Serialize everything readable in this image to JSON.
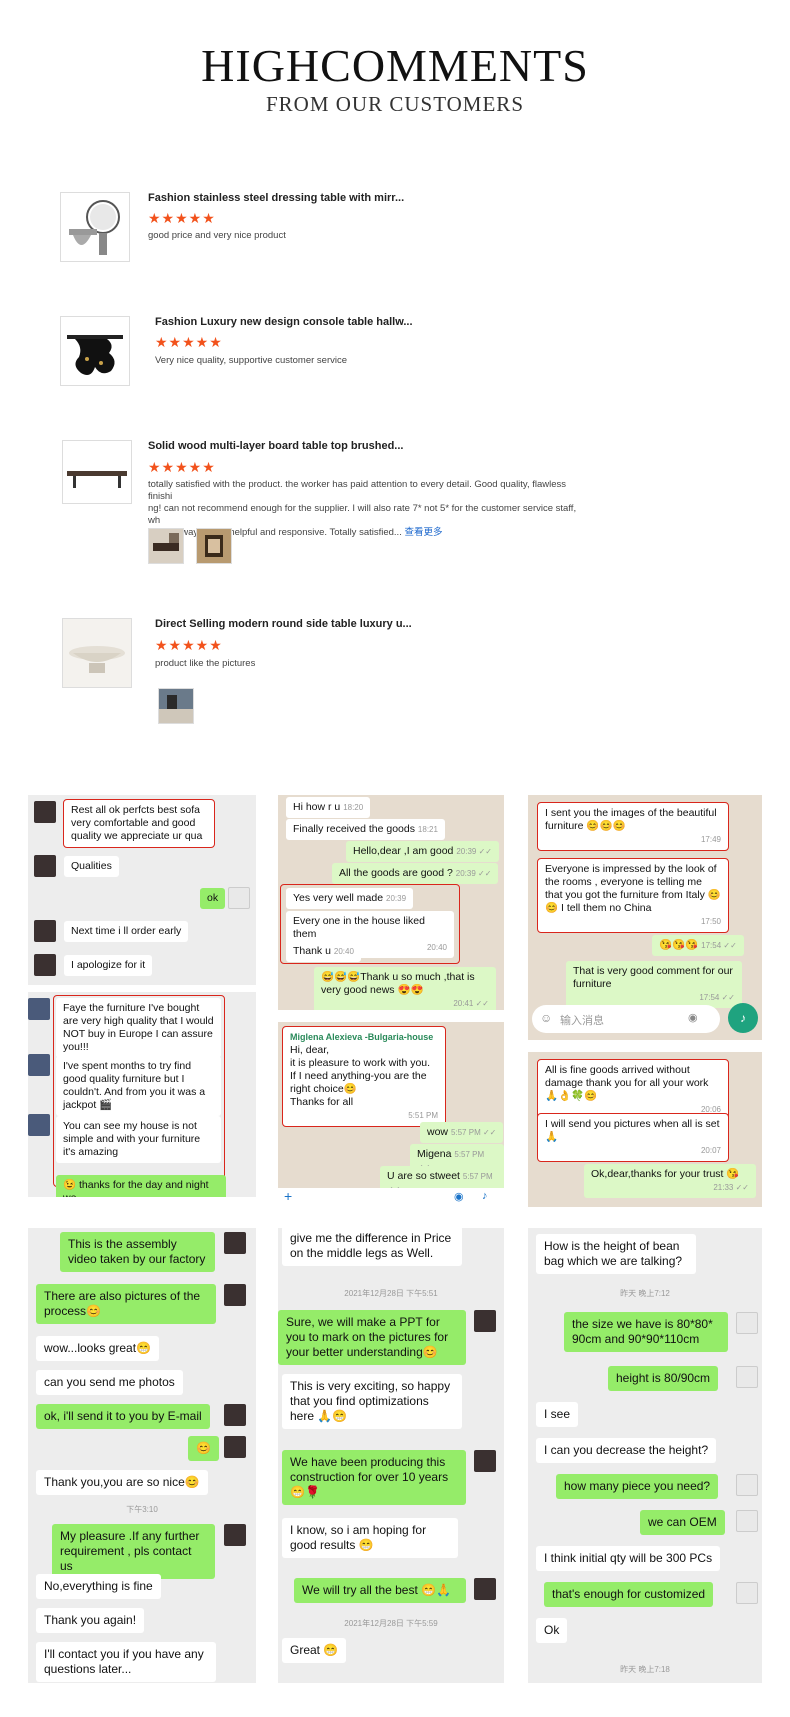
{
  "header": {
    "title": "HIGHCOMMENTS",
    "subtitle": "FROM OUR CUSTOMERS"
  },
  "reviews": [
    {
      "title": "Fashion stainless steel dressing table with mirr...",
      "stars": "★★★★★",
      "text": "good price and very nice product"
    },
    {
      "title": "Fashion Luxury new design console table hallw...",
      "stars": "★★★★★",
      "text": "Very nice quality, supportive customer service"
    },
    {
      "title": "Solid wood multi-layer board table top brushed...",
      "stars": "★★★★★",
      "text_lines": [
        "totally satisfied with the product. the worker has paid attention to every detail. Good quality, flawless finishi",
        "ng! can not recommend enough for the supplier. I will also rate 7* not 5* for the customer service staff, wh",
        "o has always been helpful and responsive. Totally satisfied..."
      ],
      "more": "查看更多"
    },
    {
      "title": "Direct Selling modern round side table luxury u...",
      "stars": "★★★★★",
      "text": "product like the pictures"
    }
  ],
  "chat1": {
    "top": [
      "Rest all ok perfcts best sofa very comfortable and good quality we appreciate ur qua",
      "Qualities",
      "ok",
      "Next time i ll order early",
      "I apologize for it"
    ],
    "bottom": [
      "Faye the furniture I've bought are very high quality that I would NOT buy in Europe I can assure you!!!",
      "I've spent months to try find good quality furniture but I couldn't. And from you it was a jackpot 🎬",
      "You can see my house is not simple and with your furniture it's amazing",
      "😉 thanks for the day and night we"
    ]
  },
  "chat2": {
    "top": [
      {
        "text": "Hi how r u",
        "time": "18:20"
      },
      {
        "text": "Finally received the goods",
        "time": "18:21"
      },
      {
        "text": "Hello,dear ,I am good",
        "time": "20:39 ✓✓"
      },
      {
        "text": "All the goods are good ?",
        "time": "20:39 ✓✓"
      },
      {
        "text": "Yes very well made",
        "time": "20:39"
      },
      {
        "text": "Every one in the house liked them",
        "time": "20:40"
      },
      {
        "text": "Thank u",
        "time": "20:40"
      },
      {
        "text": "😅😅😅Thank u so much ,that is very good news 😍😍",
        "time": "20:41 ✓✓"
      }
    ],
    "bottom": {
      "sender": "Miglena Alexieva -Bulgaria-house",
      "lines": [
        "Hi, dear,",
        "it is pleasure to work with you.",
        "If I need anything-you are the right choice😊",
        "Thanks for all"
      ],
      "time": "5:51 PM",
      "replies": [
        {
          "text": "wow",
          "time": "5:57 PM ✓✓"
        },
        {
          "text": "Migena",
          "time": "5:57 PM ✓✓"
        },
        {
          "text": "U are so stweet",
          "time": "5:57 PM ✓✓"
        }
      ]
    }
  },
  "chat3": {
    "top": [
      {
        "text": "I sent you the images of the beautiful furniture 😊😊😊",
        "time": "17:49"
      },
      {
        "text": "Everyone is impressed by the look of the rooms , everyone is telling me that you got the furniture from Italy 😊😊 I tell them no China",
        "time": "17:50"
      },
      {
        "text": "😘😘😘",
        "time": "17:54 ✓✓"
      },
      {
        "text": "That is very good comment for our furniture",
        "time": "17:54 ✓✓"
      }
    ],
    "input_placeholder": "输入消息",
    "bottom": [
      {
        "text": "All is fine goods arrived without damage thank you for all your work 🙏👌🍀😊",
        "time": "20:06"
      },
      {
        "text": "I will send you pictures when all is set 🙏",
        "time": "20:07"
      },
      {
        "text": "Ok,dear,thanks for your trust 😘",
        "time": "21:33 ✓✓"
      }
    ]
  },
  "chat4": [
    "This is the assembly video taken by our factory",
    "There are also pictures of the process😊",
    "wow...looks great😁",
    "can you send me photos",
    "ok, i'll send it to you by E-mail",
    "😊",
    "Thank you,you are so nice😊",
    "下午3:10",
    "My pleasure .If any further requirement , pls contact us",
    "No,everything is fine",
    "Thank you again!",
    "I'll contact you if you have any questions later..."
  ],
  "chat5": [
    "give me the difference in Price on the middle legs as Well.",
    "2021年12月28日 下午5:51",
    "Sure, we will make a PPT for you to mark on the pictures for your better understanding😊",
    "This is very exciting, so happy that you find optimizations here 🙏😁",
    "We have been producing this construction for over 10 years 😁🌹",
    "I know, so i am hoping for good results 😁",
    "We will try all the best 😁🙏",
    "2021年12月28日 下午5:59",
    "Great 😁"
  ],
  "chat6": [
    "How is the height of bean bag which we are talking?",
    "昨天 晚上7:12",
    "the size we have is 80*80* 90cm and 90*90*110cm",
    "height is 80/90cm",
    "I see",
    "I can you decrease the height?",
    "how many piece you need?",
    "we can OEM",
    "I think initial qty will be 300 PCs",
    "that's enough for customized",
    "Ok",
    "昨天 晚上7:18"
  ]
}
